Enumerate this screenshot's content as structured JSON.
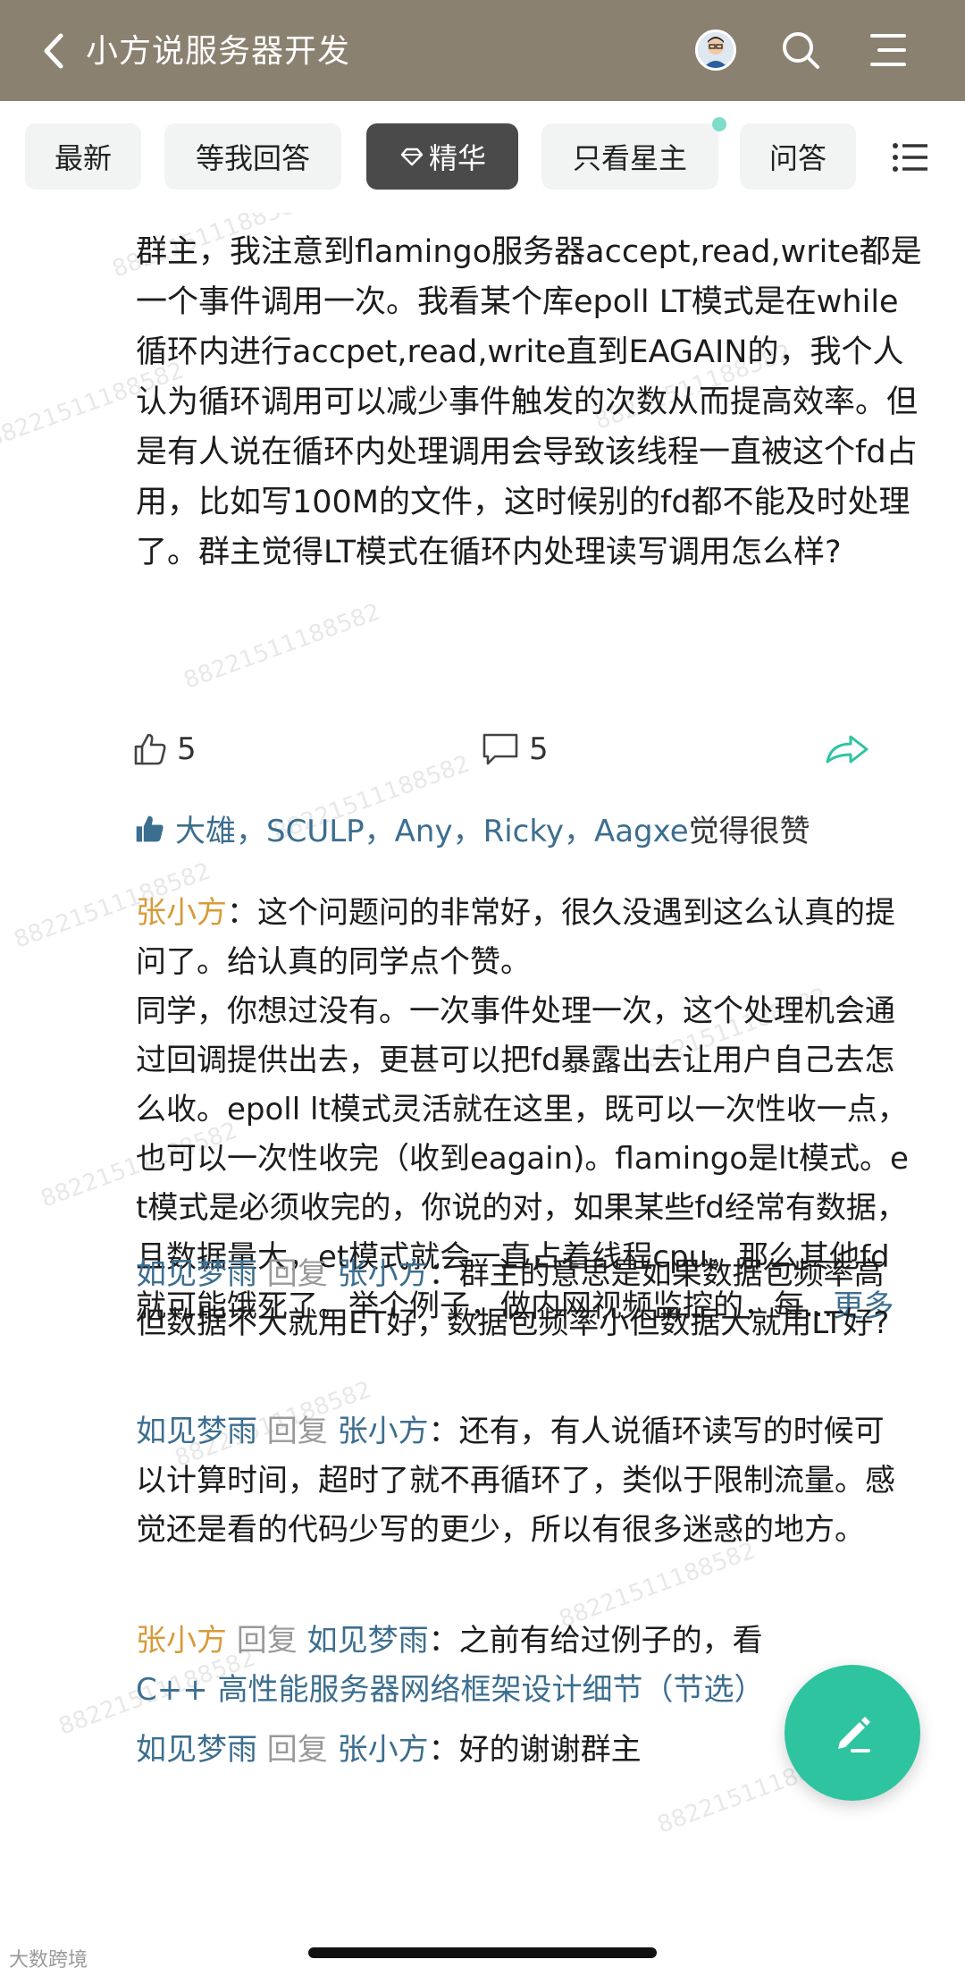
{
  "header": {
    "title": "小方说服务器开发",
    "icons": [
      "back-icon",
      "avatar",
      "search-icon",
      "menu-icon"
    ]
  },
  "tabs": {
    "items": [
      "最新",
      "等我回答",
      "精华",
      "只看星主",
      "问答"
    ],
    "active": "精华"
  },
  "question": {
    "text": "群主，我注意到flamingo服务器accept,read,write都是一个事件调用一次。我看某个库epoll LT模式是在while循环内进行accpet,read,write直到EAGAIN的，我个人认为循环调用可以减少事件触发的次数从而提高效率。但是有人说在循环内处理调用会导致该线程一直被这个fd占用，比如写100M的文件，这时候别的fd都不能及时处理了。群主觉得LT模式在循环内处理读写调用怎么样?"
  },
  "stats": {
    "likes": "5",
    "comments": "5"
  },
  "likers": {
    "names": "大雄，SCULP，Any，Ricky，Aagxe",
    "suffix": " 觉得很赞"
  },
  "comments": [
    {
      "author": "张小方",
      "sep": "：",
      "text": "这个问题问的非常好，很久没遇到这么认真的提问了。给认真的同学点个赞。",
      "text2": "同学，你想过没有。一次事件处理一次，这个处理机会通过回调提供出去，更甚可以把fd暴露出去让用户自己去怎么收。epoll lt模式灵活就在这里，既可以一次性收一点，也可以一次性收完（收到eagain)。flamingo是lt模式。et模式是必须收完的，你说的对，如果某些fd经常有数据，且数据量大，et模式就会一直占着线程cpu。那么其他fd就可能饿死了。举个例子，做内网视频监控的，每...",
      "more": "更多"
    },
    {
      "author": "如见梦雨",
      "reply": " 回复 ",
      "target": "张小方",
      "sep": "：",
      "text": "群主的意思是如果数据包频率高但数据不大就用ET好，数据包频率小但数据大就用LT好?"
    },
    {
      "author": "如见梦雨",
      "reply": " 回复 ",
      "target": "张小方",
      "sep": "：",
      "text": "还有，有人说循环读写的时候可以计算时间，超时了就不再循环了，类似于限制流量。感觉还是看的代码少写的更少，所以有很多迷惑的地方。"
    },
    {
      "author": "张小方",
      "reply": " 回复 ",
      "target": "如见梦雨",
      "sep": "：",
      "text": "之前有给过例子的，看",
      "link": "C++ 高性能服务器网络框架设计细节（节选）"
    },
    {
      "author": "如见梦雨",
      "reply": " 回复 ",
      "target": "张小方",
      "sep": "：",
      "text": "好的谢谢群主"
    }
  ],
  "watermark": "88221511188582",
  "corner_mark": "大数跨境",
  "colors": {
    "header_bg": "#8a8170",
    "fab_bg": "#2ec4a0",
    "author_orange": "#d89b3a",
    "author_blue": "#3c6e8f",
    "tab_active_bg": "#4a4a4a"
  }
}
